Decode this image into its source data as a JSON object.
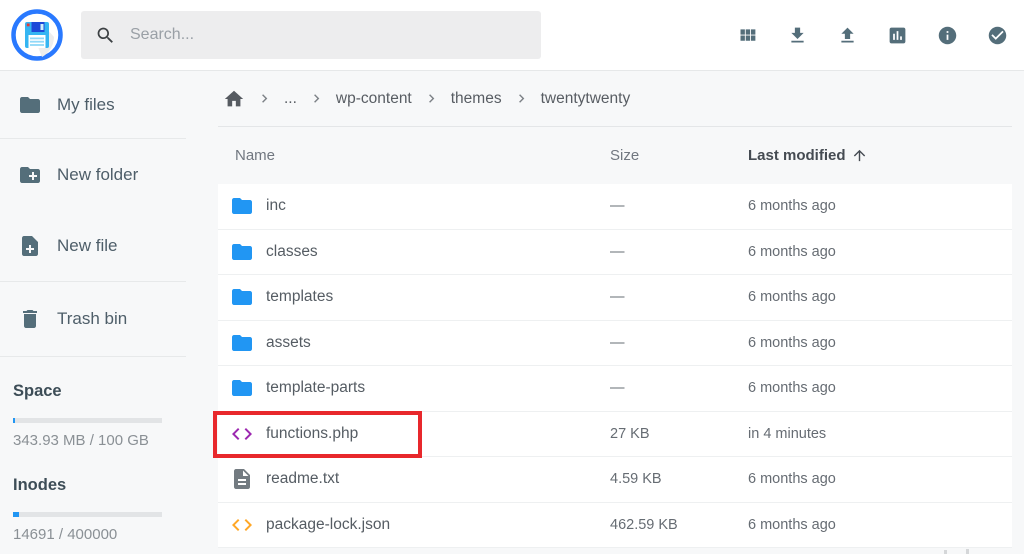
{
  "header": {
    "search_placeholder": "Search...",
    "action_icons": [
      "grid-view-icon",
      "download-icon",
      "upload-icon",
      "stats-icon",
      "info-icon",
      "check-circle-icon"
    ]
  },
  "sidebar": {
    "groups": [
      {
        "items": [
          {
            "icon": "folder-icon",
            "label": "My files"
          }
        ]
      },
      {
        "items": [
          {
            "icon": "new-folder-icon",
            "label": "New folder"
          },
          {
            "icon": "new-file-icon",
            "label": "New file"
          }
        ]
      },
      {
        "items": [
          {
            "icon": "trash-icon",
            "label": "Trash bin"
          }
        ]
      }
    ],
    "space": {
      "label": "Space",
      "caption": "343.93 MB / 100 GB",
      "percent": 0.35
    },
    "inodes": {
      "label": "Inodes",
      "caption": "14691 / 400000",
      "percent": 3.7
    }
  },
  "breadcrumb": {
    "items": [
      "...",
      "wp-content",
      "themes",
      "twentytwenty"
    ]
  },
  "table": {
    "headers": {
      "name": "Name",
      "size": "Size",
      "modified": "Last modified"
    },
    "sort": {
      "column": "modified",
      "direction": "ascending"
    },
    "rows": [
      {
        "icon": "folder-icon",
        "icon_color": "#2196f3",
        "name": "inc",
        "size": "—",
        "modified": "6 months ago",
        "highlighted": false
      },
      {
        "icon": "folder-icon",
        "icon_color": "#2196f3",
        "name": "classes",
        "size": "—",
        "modified": "6 months ago",
        "highlighted": false
      },
      {
        "icon": "folder-icon",
        "icon_color": "#2196f3",
        "name": "templates",
        "size": "—",
        "modified": "6 months ago",
        "highlighted": false
      },
      {
        "icon": "folder-icon",
        "icon_color": "#2196f3",
        "name": "assets",
        "size": "—",
        "modified": "6 months ago",
        "highlighted": false
      },
      {
        "icon": "folder-icon",
        "icon_color": "#2196f3",
        "name": "template-parts",
        "size": "—",
        "modified": "6 months ago",
        "highlighted": false
      },
      {
        "icon": "code-icon",
        "icon_color": "#9c27b0",
        "name": "functions.php",
        "size": "27 KB",
        "modified": "in 4 minutes",
        "highlighted": true
      },
      {
        "icon": "file-text-icon",
        "icon_color": "#737b81",
        "name": "readme.txt",
        "size": "4.59 KB",
        "modified": "6 months ago",
        "highlighted": false
      },
      {
        "icon": "code-icon",
        "icon_color": "#ffa726",
        "name": "package-lock.json",
        "size": "462.59 KB",
        "modified": "6 months ago",
        "highlighted": false
      }
    ]
  },
  "colors": {
    "accent_blue": "#2196f3",
    "toolbar_icon_slate": "#546e7a",
    "highlight_red": "#e8282c",
    "folder_blue": "#2196f3",
    "php_purple": "#9c27b0",
    "json_orange": "#ffa726",
    "logo_ring_blue": "#2979ff",
    "logo_disk_blue": "#35b5f2"
  }
}
